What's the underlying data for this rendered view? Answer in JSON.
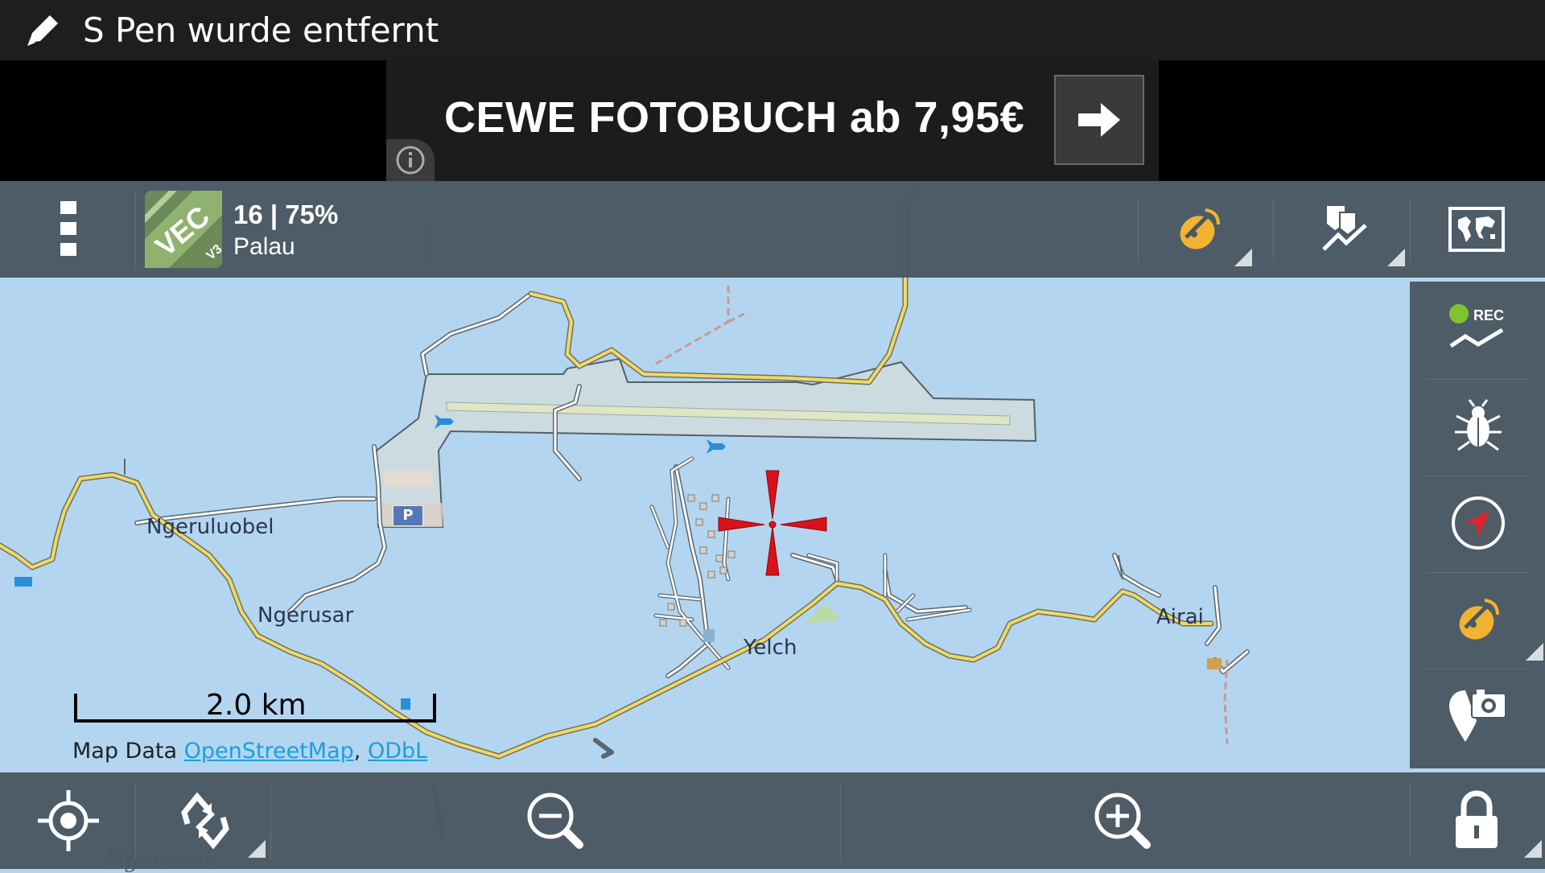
{
  "status_bar": {
    "message": "S Pen wurde entfernt",
    "icon": "pen-icon"
  },
  "ad": {
    "text": "CEWE FOTOBUCH ab 7,95€",
    "arrow_icon": "arrow-right-icon",
    "info_icon": "info-icon"
  },
  "toolbar": {
    "menu_icon": "menu-dots-icon",
    "map_logo_text": "VEC",
    "map_logo_sub": "V3",
    "zoom_battery": "16 | 75%",
    "map_name": "Palau",
    "gps_icon": "satellite-icon",
    "tracks_icon": "route-icon",
    "world_map_icon": "world-map-icon"
  },
  "right_panel": {
    "rec_label": "REC",
    "buttons": [
      "record-track-icon",
      "bug-icon",
      "compass-icon",
      "satellite-icon",
      "photo-pin-icon"
    ]
  },
  "bottom_bar": {
    "buttons": [
      "locate-icon",
      "rotate-icon",
      "zoom-out-icon",
      "zoom-in-icon",
      "lock-icon"
    ]
  },
  "map": {
    "places": [
      "Ngeruluobel",
      "Ngerusar",
      "Yelch",
      "Airai",
      "Ngeream"
    ],
    "parking_label": "P",
    "scale_label": "2.0 km",
    "attribution_prefix": "Map Data",
    "attribution_osm": "OpenStreetMap",
    "attribution_sep": ",",
    "attribution_license": "ODbL"
  },
  "colors": {
    "water": "#b3d5ef",
    "road_major": "#e8d26a",
    "toolbar": "#4a5862",
    "crosshair": "#d8121a"
  }
}
